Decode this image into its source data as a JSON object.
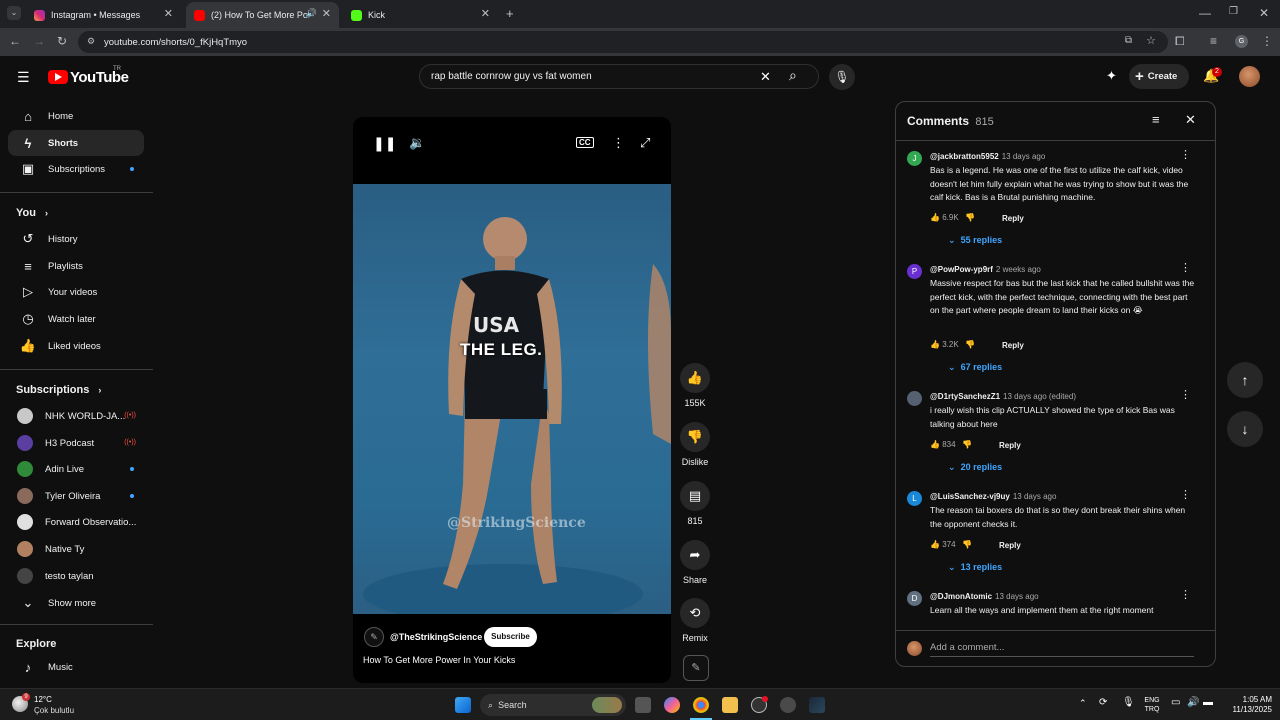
{
  "browser": {
    "tabs": [
      {
        "title": "Instagram • Messages",
        "active": false
      },
      {
        "title": "(2) How To Get More Power",
        "active": true
      },
      {
        "title": "Kick",
        "active": false
      }
    ],
    "url": "youtube.com/shorts/0_fKjHqTmyo"
  },
  "header": {
    "logo": "YouTube",
    "region": "TR",
    "search_value": "rap battle cornrow guy vs fat women",
    "create_label": "Create",
    "notification_count": "2"
  },
  "sidebar": {
    "main": [
      {
        "label": "Home",
        "icon": "home-icon"
      },
      {
        "label": "Shorts",
        "icon": "shorts-icon"
      },
      {
        "label": "Subscriptions",
        "icon": "subscriptions-icon"
      }
    ],
    "you_heading": "You",
    "you_items": [
      {
        "label": "History",
        "icon": "history-icon"
      },
      {
        "label": "Playlists",
        "icon": "playlists-icon"
      },
      {
        "label": "Your videos",
        "icon": "your-videos-icon"
      },
      {
        "label": "Watch later",
        "icon": "watch-later-icon"
      },
      {
        "label": "Liked videos",
        "icon": "liked-videos-icon"
      }
    ],
    "subs_heading": "Subscriptions",
    "subs": [
      {
        "label": "NHK WORLD-JA...",
        "color": "#c8c8c8",
        "badge": "live"
      },
      {
        "label": "H3 Podcast",
        "color": "#5a3fa0",
        "badge": "live"
      },
      {
        "label": "Adin Live",
        "color": "#2f8a3a",
        "badge": "dot"
      },
      {
        "label": "Tyler Oliveira",
        "color": "#8a6a5a",
        "badge": "dot"
      },
      {
        "label": "Forward Observatio...",
        "color": "#e0e0e0",
        "badge": ""
      },
      {
        "label": "Native Ty",
        "color": "#b08060",
        "badge": ""
      },
      {
        "label": "testo taylan",
        "color": "#444444",
        "badge": ""
      }
    ],
    "show_more": "Show more",
    "explore_heading": "Explore",
    "explore_items": [
      {
        "label": "Music",
        "icon": "music-icon"
      }
    ]
  },
  "video": {
    "caption": "THE LEG.",
    "watermark": "@StrikingScience",
    "channel": "@TheStrikingScience",
    "subscribe_label": "Subscribe",
    "title": "How To Get More Power In Your Kicks"
  },
  "actions": {
    "like_count": "155K",
    "dislike_label": "Dislike",
    "comment_count": "815",
    "share_label": "Share",
    "remix_label": "Remix"
  },
  "comments": {
    "heading": "Comments",
    "count": "815",
    "items": [
      {
        "author": "@jackbratton5952",
        "time": "13 days ago",
        "avatar_letter": "J",
        "avatar_color": "#33a852",
        "text": "Bas is a legend. He was one of the first to utilize the calf kick, video doesn't let him fully explain what he was trying to show but it was the calf kick. Bas is a Brutal punishing machine.",
        "likes": "6.9K",
        "reply_label": "Reply",
        "replies": "55 replies"
      },
      {
        "author": "@PowPow-yp9rf",
        "time": "2 weeks ago",
        "avatar_letter": "P",
        "avatar_color": "#6a2fd0",
        "text": "Massive respect for bas but the last kick that he called bullshit was the perfect kick, with the perfect technique, connecting with the best part on the part where people dream to land their kicks on 😭",
        "likes": "3.2K",
        "reply_label": "Reply",
        "replies": "67 replies"
      },
      {
        "author": "@D1rtySanchezZ1",
        "time": "13 days ago (edited)",
        "avatar_letter": "",
        "avatar_color": "#556070",
        "text": "i really wish this clip ACTUALLY showed the type of kick Bas was talking about here",
        "likes": "834",
        "reply_label": "Reply",
        "replies": "20 replies"
      },
      {
        "author": "@LuisSanchez-vj9uy",
        "time": "13 days ago",
        "avatar_letter": "L",
        "avatar_color": "#1a88d8",
        "text": "The reason tai boxers do that is so they dont break their shins when the opponent checks it.",
        "likes": "374",
        "reply_label": "Reply",
        "replies": "13 replies"
      },
      {
        "author": "@DJmonAtomic",
        "time": "13 days ago",
        "avatar_letter": "D",
        "avatar_color": "#607080",
        "text": "Learn all the ways and implement them at the right moment",
        "likes": "",
        "reply_label": "",
        "replies": ""
      }
    ],
    "add_placeholder": "Add a comment..."
  },
  "taskbar": {
    "weather_temp": "12°C",
    "weather_text": "Çok bulutlu",
    "search_label": "Search",
    "lang_top": "ENG",
    "lang_bottom": "TRQ",
    "time": "1:05 AM",
    "date": "11/13/2025",
    "weather_badge": "9"
  }
}
